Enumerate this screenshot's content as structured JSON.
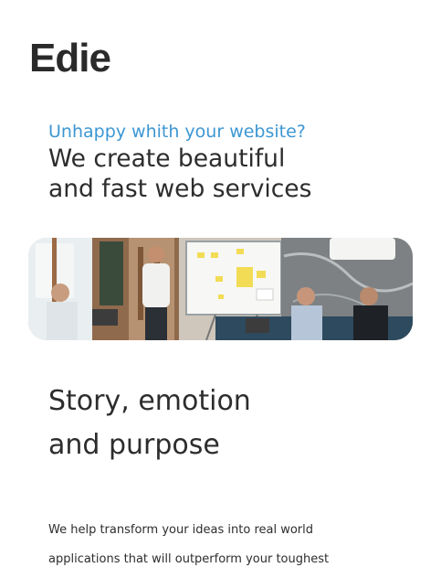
{
  "brand": {
    "name": "Edie"
  },
  "hero": {
    "eyebrow": "Unhappy whith your website?",
    "title_lines": [
      "We create beautiful",
      "and fast web services"
    ],
    "image_label": "team-meeting-whiteboard-photo"
  },
  "story": {
    "title_lines": [
      "Story, emotion",
      "and purpose"
    ],
    "body_lines": [
      "We help transform your ideas into real world",
      "applications that will outperform your toughest"
    ]
  },
  "colors": {
    "accent": "#3d97d3",
    "text": "#2d2d2d",
    "background": "#ffffff"
  }
}
